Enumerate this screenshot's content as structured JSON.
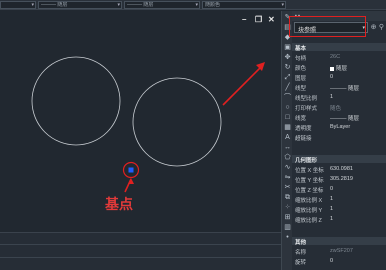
{
  "toolbar": {
    "selects": [
      {
        "label": ""
      },
      {
        "label": "——— 随层"
      },
      {
        "label": "——— 随层"
      },
      {
        "label": "随颜色"
      }
    ]
  },
  "properties_panel": {
    "object_type": "块参照",
    "sections": {
      "basic": {
        "title": "基本",
        "rows": [
          {
            "key": "句柄",
            "value": "26C"
          },
          {
            "key": "颜色",
            "value": "随层"
          },
          {
            "key": "图层",
            "value": "0"
          },
          {
            "key": "线型",
            "value": "——— 随层"
          },
          {
            "key": "线型比例",
            "value": "1"
          },
          {
            "key": "打印样式",
            "value": "随色"
          },
          {
            "key": "线宽",
            "value": "——— 随层"
          },
          {
            "key": "透明度",
            "value": "ByLayer"
          },
          {
            "key": "超链接",
            "value": ""
          }
        ]
      },
      "geometry": {
        "title": "几何图形",
        "rows": [
          {
            "key": "位置 X 坐标",
            "value": "630.0981"
          },
          {
            "key": "位置 Y 坐标",
            "value": "305.2819"
          },
          {
            "key": "位置 Z 坐标",
            "value": "0"
          },
          {
            "key": "缩放比例 X",
            "value": "1"
          },
          {
            "key": "缩放比例 Y",
            "value": "1"
          },
          {
            "key": "缩放比例 Z",
            "value": "1"
          }
        ]
      },
      "misc": {
        "title": "其他",
        "rows": [
          {
            "key": "名称",
            "value": "zwSF207"
          },
          {
            "key": "旋转",
            "value": "0"
          }
        ]
      }
    }
  },
  "annotation": {
    "label": "基点"
  },
  "colors": {
    "highlight": "#e02020",
    "grip": "#1e5cff",
    "background": "#212830"
  }
}
